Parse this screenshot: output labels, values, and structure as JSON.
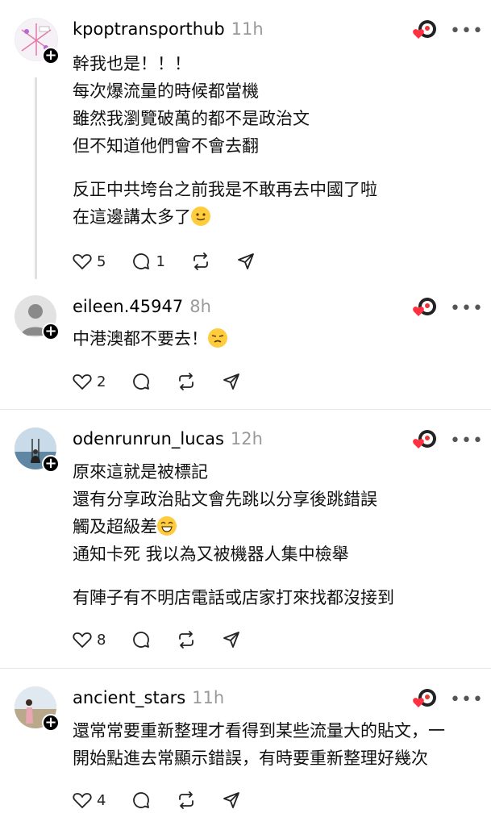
{
  "posts": [
    {
      "username": "kpoptransporthub",
      "time": "11h",
      "lines": [
        "幹我也是！！！",
        "每次爆流量的時候都當機",
        "雖然我瀏覽破萬的都不是政治文",
        "但不知道他們會不會去翻"
      ],
      "lines2": [
        "反正中共垮台之前我是不敢再去中國了啦",
        "在這邊講太多了"
      ],
      "likes": "5",
      "replies": "1"
    },
    {
      "username": "eileen.45947",
      "time": "8h",
      "lines": [
        "中港澳都不要去！"
      ],
      "likes": "2"
    },
    {
      "username": "odenrunrun_lucas",
      "time": "12h",
      "lines": [
        "原來這就是被標記",
        "還有分享政治貼文會先跳以分享後跳錯誤",
        "觸及超級差",
        "通知卡死 我以為又被機器人集中檢舉"
      ],
      "lines2": [
        "有陣子有不明店電話或店家打來找都沒接到"
      ],
      "likes": "8"
    },
    {
      "username": "ancient_stars",
      "time": "11h",
      "lines": [
        "還常常要重新整理才看得到某些流量大的貼文，一",
        "開始點進去常顯示錯誤，有時要重新整理好幾次"
      ],
      "likes": "4"
    }
  ],
  "ui": {
    "more": "•••",
    "plus": "+"
  },
  "colors": {
    "accent_heart": "#ff3040",
    "muted": "#9a9a9a",
    "divider": "#e5e5e5"
  },
  "icons": [
    "heart-icon",
    "comment-icon",
    "repost-icon",
    "share-icon",
    "more-icon",
    "follow-plus-icon",
    "reaction-icon"
  ]
}
